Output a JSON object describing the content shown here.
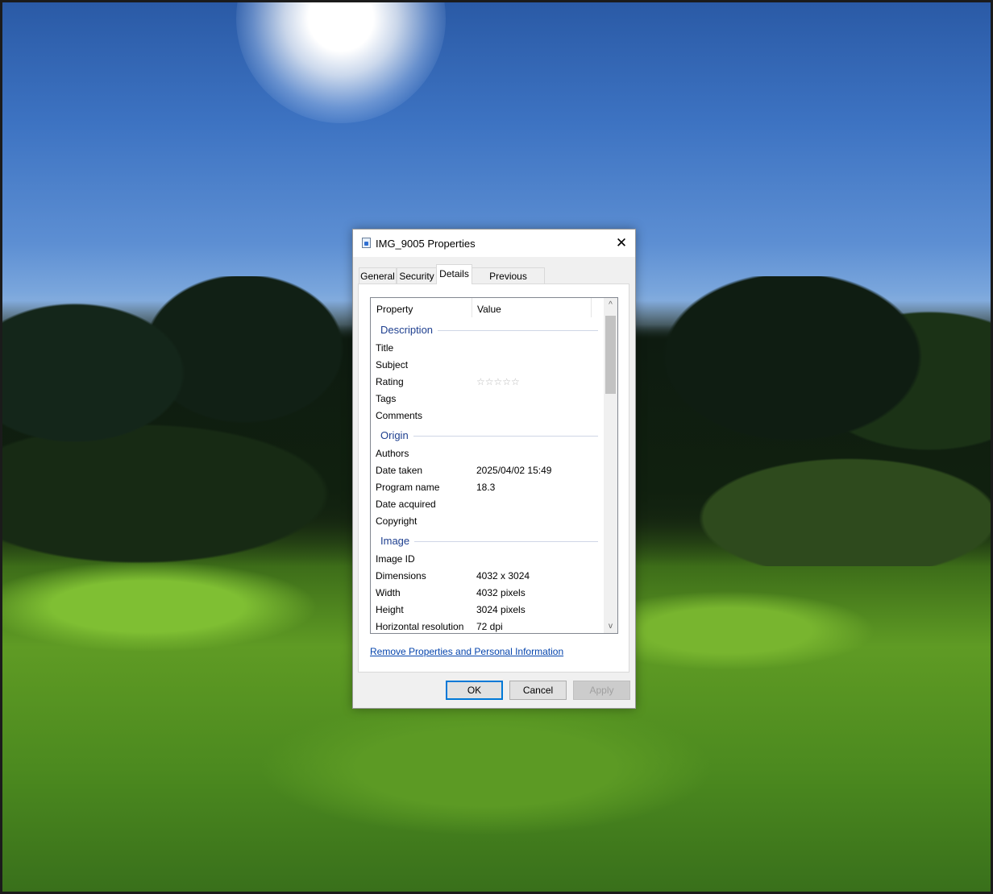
{
  "window": {
    "title": "IMG_9005 Properties",
    "close_symbol": "✕"
  },
  "tabs": [
    {
      "label": "General"
    },
    {
      "label": "Security"
    },
    {
      "label": "Details",
      "active": true
    },
    {
      "label": "Previous Versions"
    }
  ],
  "details": {
    "columns": {
      "property": "Property",
      "value": "Value"
    },
    "groups": {
      "description": "Description",
      "origin": "Origin",
      "image": "Image"
    },
    "rows": {
      "title": {
        "property": "Title",
        "value": ""
      },
      "subject": {
        "property": "Subject",
        "value": ""
      },
      "rating": {
        "property": "Rating",
        "value": "☆☆☆☆☆",
        "stars": 0,
        "max_stars": 5
      },
      "tags": {
        "property": "Tags",
        "value": ""
      },
      "comments": {
        "property": "Comments",
        "value": ""
      },
      "authors": {
        "property": "Authors",
        "value": ""
      },
      "date_taken": {
        "property": "Date taken",
        "value": "2025/04/02 15:49"
      },
      "program_name": {
        "property": "Program name",
        "value": "18.3"
      },
      "date_acquired": {
        "property": "Date acquired",
        "value": ""
      },
      "copyright": {
        "property": "Copyright",
        "value": ""
      },
      "image_id": {
        "property": "Image ID",
        "value": ""
      },
      "dimensions": {
        "property": "Dimensions",
        "value": "4032 x 3024"
      },
      "width": {
        "property": "Width",
        "value": "4032 pixels"
      },
      "height": {
        "property": "Height",
        "value": "3024 pixels"
      },
      "horizontal_resolution": {
        "property": "Horizontal resolution",
        "value": "72 dpi"
      }
    },
    "scrollbar": {
      "up": "^",
      "down": "v"
    }
  },
  "remove_link": "Remove Properties and Personal Information",
  "buttons": {
    "ok": "OK",
    "cancel": "Cancel",
    "apply": "Apply"
  }
}
